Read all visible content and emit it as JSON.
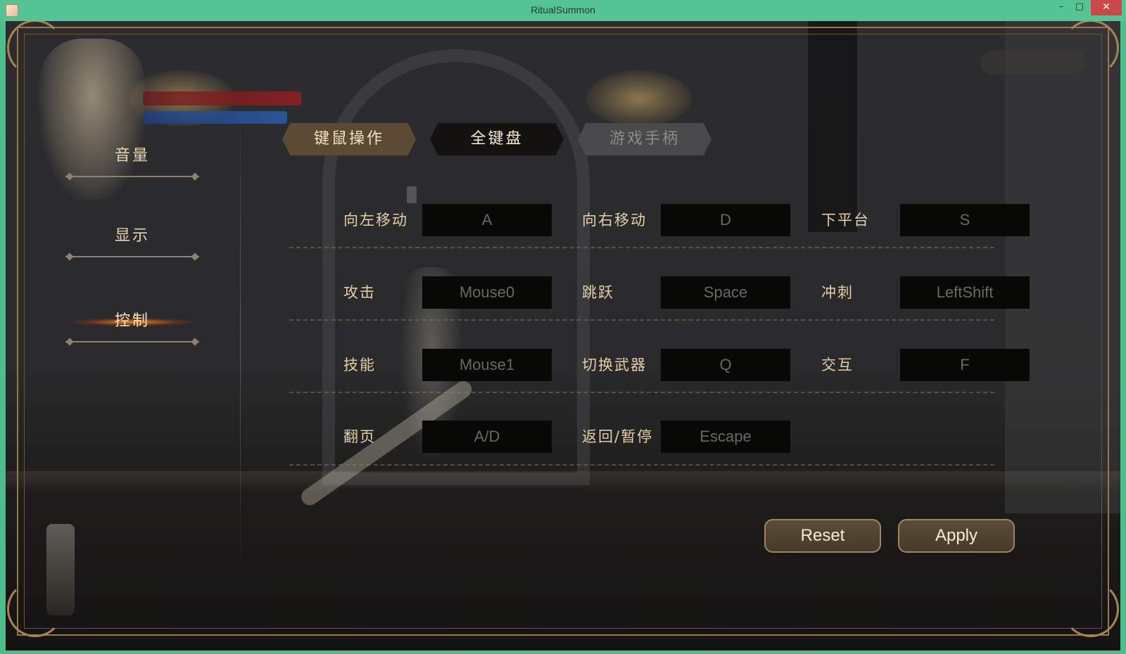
{
  "window": {
    "title": "RitualSummon",
    "minimize": "–",
    "maximize": "□",
    "close": "✕"
  },
  "menu": {
    "items": [
      {
        "label": "音量"
      },
      {
        "label": "显示"
      },
      {
        "label": "控制",
        "active": true
      }
    ]
  },
  "tabs": [
    {
      "label": "键鼠操作"
    },
    {
      "label": "全键盘",
      "selected": true
    },
    {
      "label": "游戏手柄"
    }
  ],
  "bindings": [
    [
      {
        "action": "向左移动",
        "key": "A"
      },
      {
        "action": "向右移动",
        "key": "D"
      },
      {
        "action": "下平台",
        "key": "S"
      }
    ],
    [
      {
        "action": "攻击",
        "key": "Mouse0"
      },
      {
        "action": "跳跃",
        "key": "Space"
      },
      {
        "action": "冲刺",
        "key": "LeftShift"
      }
    ],
    [
      {
        "action": "技能",
        "key": "Mouse1"
      },
      {
        "action": "切换武器",
        "key": "Q"
      },
      {
        "action": "交互",
        "key": "F"
      }
    ],
    [
      {
        "action": "翻页",
        "key": "A/D"
      },
      {
        "action": "返回/暂停",
        "key": "Escape"
      }
    ]
  ],
  "buttons": {
    "reset": "Reset",
    "apply": "Apply"
  },
  "colors": {
    "window_frame": "#55c394",
    "gold_text": "#e3cfa9",
    "key_box": "#080807",
    "active_glow": "#ff8c28"
  }
}
